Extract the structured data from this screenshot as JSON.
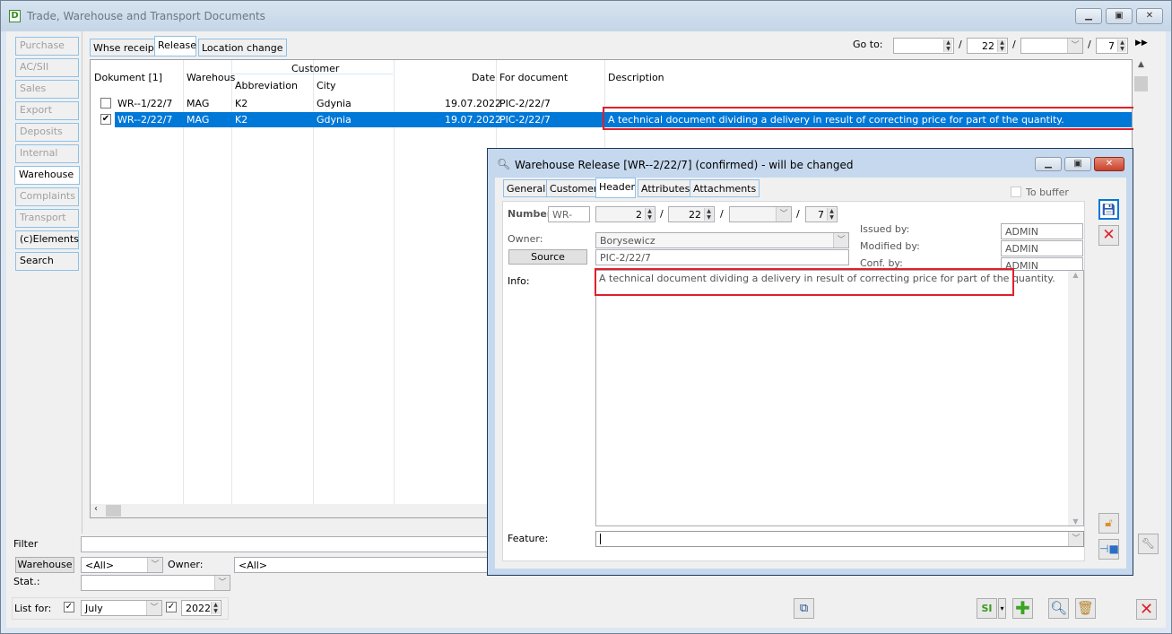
{
  "window": {
    "title": "Trade, Warehouse and Transport Documents",
    "icon": "document-d-icon",
    "controls": {
      "minimize": "▭",
      "maximize": "▢",
      "close": "✕"
    }
  },
  "sidebar": {
    "items": [
      {
        "label": "Purchase",
        "enabled": false
      },
      {
        "label": "AC/SII",
        "enabled": false
      },
      {
        "label": "Sales",
        "enabled": false
      },
      {
        "label": "Export",
        "enabled": false
      },
      {
        "label": "Deposits",
        "enabled": false
      },
      {
        "label": "Internal",
        "enabled": false
      },
      {
        "label": "Warehouse",
        "enabled": true,
        "selected": true
      },
      {
        "label": "Complaints",
        "enabled": false
      },
      {
        "label": "Transport",
        "enabled": false
      },
      {
        "label": "(c)Elements",
        "enabled": true
      },
      {
        "label": "Search",
        "enabled": true
      }
    ]
  },
  "tabs": [
    {
      "label": "Whse receipt"
    },
    {
      "label": "Release",
      "selected": true
    },
    {
      "label": "Location change"
    }
  ],
  "goto": {
    "label": "Go to:",
    "field1": "",
    "sep": "/",
    "year": "22",
    "series": "",
    "month": "7",
    "go_icon": "▶▶"
  },
  "table": {
    "headers": {
      "document": "Dokument [1]",
      "warehouse": "Warehous",
      "customer_group": "Customer",
      "abbreviation": "Abbreviation",
      "city": "City",
      "date": "Date",
      "for_document": "For document",
      "description": "Description"
    },
    "rows": [
      {
        "checked": false,
        "document": "WR--1/22/7",
        "warehouse": "MAG",
        "abbreviation": "K2",
        "city": "Gdynia",
        "date": "19.07.2022",
        "for_document": "PIC-2/22/7",
        "description": ""
      },
      {
        "checked": true,
        "selected": true,
        "document": "WR--2/22/7",
        "warehouse": "MAG",
        "abbreviation": "K2",
        "city": "Gdynia",
        "date": "19.07.2022",
        "for_document": "PIC-2/22/7",
        "description": "A technical document dividing a delivery in result of correcting price for part of the quantity."
      }
    ],
    "check_mark": "✔"
  },
  "filters": {
    "filter_label": "Filter",
    "filter_value": "",
    "warehouse_button": "Warehouse",
    "warehouse_value": "<All>",
    "owner_label": "Owner:",
    "owner_value": "<All>",
    "stat_label": "Stat.:",
    "stat_value": "",
    "list_for_label": "List for:",
    "month_value": "July",
    "year_value": "2022",
    "month_checked": true,
    "year_checked": true
  },
  "bottom_toolbar": {
    "export_icon": "export-pages-icon",
    "si_icon": "SI",
    "add_icon": "add-icon",
    "search_icon": "search-icon",
    "delete_icon": "trash-icon",
    "close_icon": "close-icon"
  },
  "dialog": {
    "title": "Warehouse Release [WR--2/22/7] (confirmed) - will be changed",
    "tabs": [
      {
        "label": "General"
      },
      {
        "label": "Customer"
      },
      {
        "label": "Header",
        "selected": true
      },
      {
        "label": "Attributes"
      },
      {
        "label": "Attachments"
      }
    ],
    "to_buffer_label": "To buffer",
    "to_buffer_checked": false,
    "number_label": "Number",
    "number_prefix": "WR-",
    "number": "2",
    "year": "22",
    "series": "",
    "month": "7",
    "sep": "/",
    "owner_label": "Owner:",
    "owner_value": "Borysewicz",
    "source_button": "Source",
    "source_value": "PIC-2/22/7",
    "issued_by_label": "Issued by:",
    "issued_by": "ADMIN",
    "modified_by_label": "Modified by:",
    "modified_by": "ADMIN",
    "conf_by_label": "Conf. by:",
    "conf_by": "ADMIN",
    "info_label": "Info:",
    "info_text": "A technical document dividing a delivery in result of correcting price for part of the quantity.",
    "feature_label": "Feature:",
    "feature_value": ""
  }
}
